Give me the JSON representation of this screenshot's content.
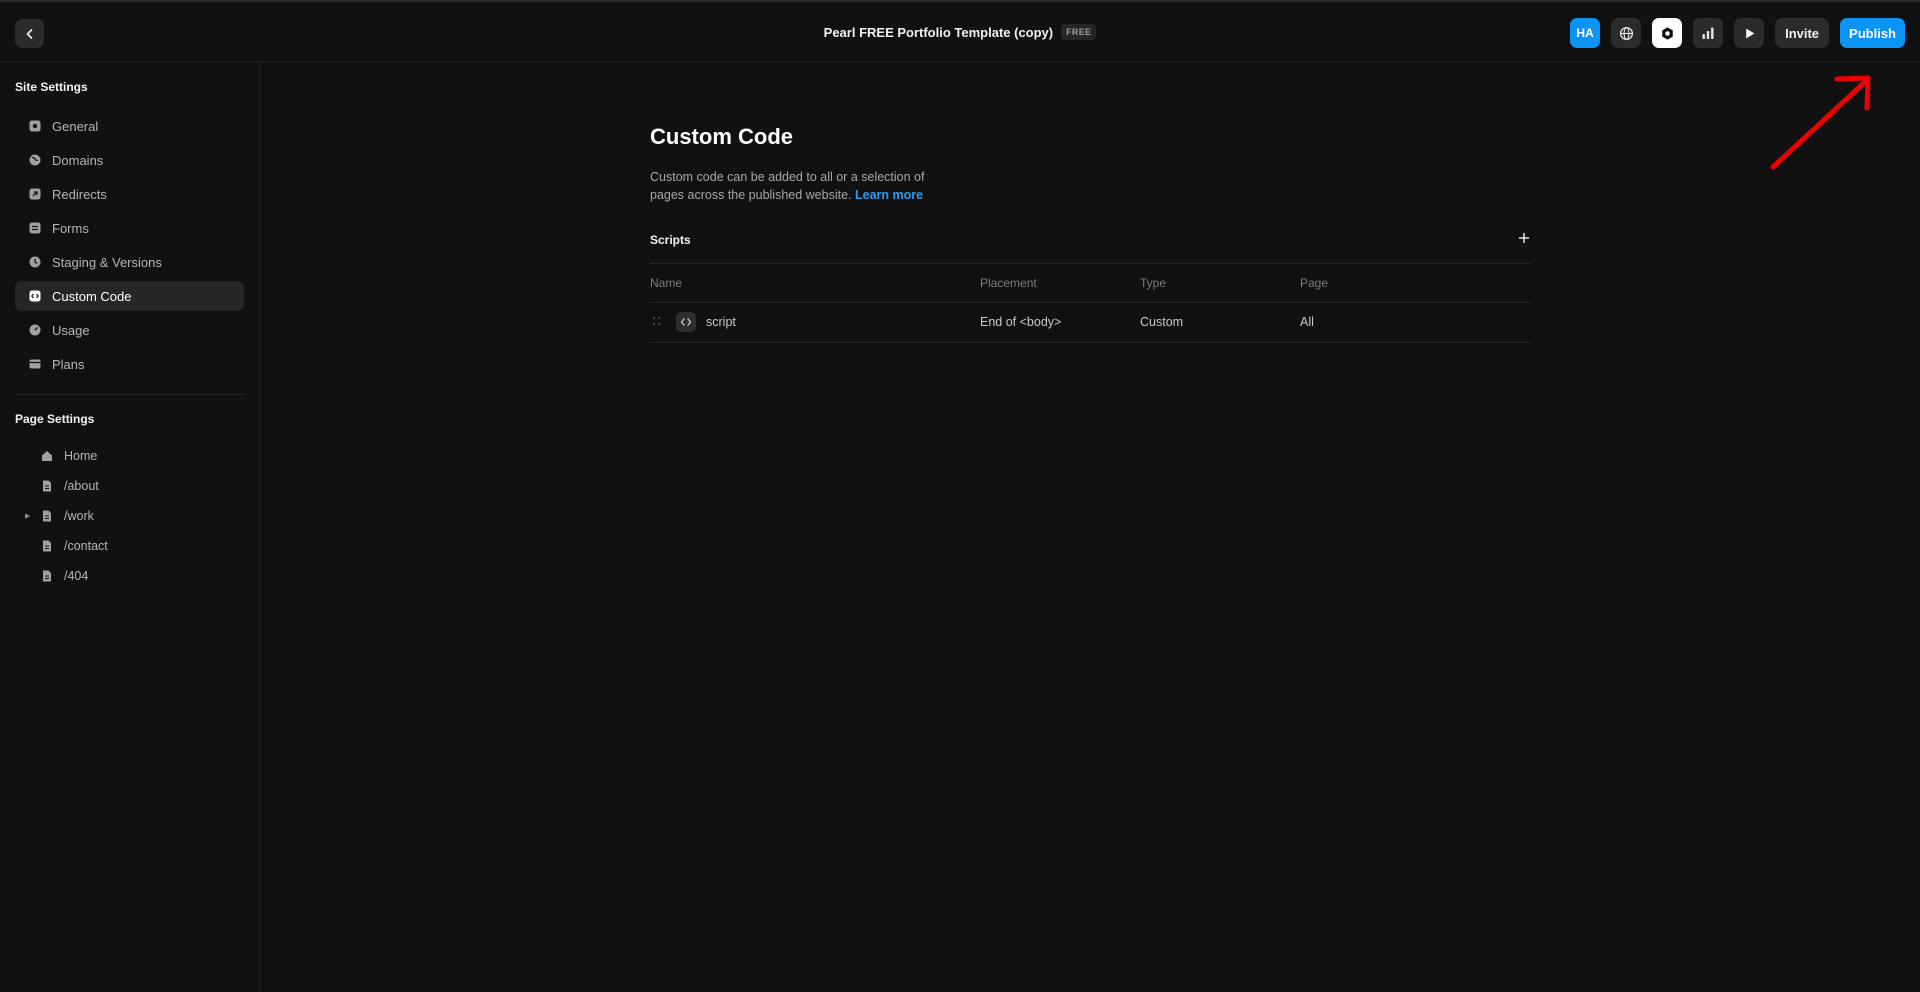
{
  "header": {
    "project_title": "Pearl FREE Portfolio Template (copy)",
    "badge": "FREE",
    "avatar_initials": "HA",
    "invite_label": "Invite",
    "publish_label": "Publish",
    "accent_color": "#0a94f6"
  },
  "sidebar": {
    "site_settings_title": "Site Settings",
    "items": [
      {
        "label": "General",
        "icon": "gear-icon"
      },
      {
        "label": "Domains",
        "icon": "globe-icon"
      },
      {
        "label": "Redirects",
        "icon": "redirect-arrow-icon"
      },
      {
        "label": "Forms",
        "icon": "form-icon"
      },
      {
        "label": "Staging & Versions",
        "icon": "clock-icon"
      },
      {
        "label": "Custom Code",
        "icon": "code-icon",
        "active": true
      },
      {
        "label": "Usage",
        "icon": "gauge-icon"
      },
      {
        "label": "Plans",
        "icon": "card-icon"
      }
    ],
    "page_settings_title": "Page Settings",
    "pages": [
      {
        "label": "Home",
        "icon": "home-icon"
      },
      {
        "label": "/about",
        "icon": "page-icon"
      },
      {
        "label": "/work",
        "icon": "page-icon",
        "expandable": true
      },
      {
        "label": "/contact",
        "icon": "page-icon"
      },
      {
        "label": "/404",
        "icon": "page-icon"
      }
    ]
  },
  "main": {
    "title": "Custom Code",
    "description": "Custom code can be added to all or a selection of pages across the published website.",
    "learn_more": "Learn more",
    "scripts_label": "Scripts",
    "columns": [
      "Name",
      "Placement",
      "Type",
      "Page"
    ],
    "rows": [
      {
        "name": "script",
        "placement": "End of <body>",
        "type": "Custom",
        "page": "All"
      }
    ]
  }
}
